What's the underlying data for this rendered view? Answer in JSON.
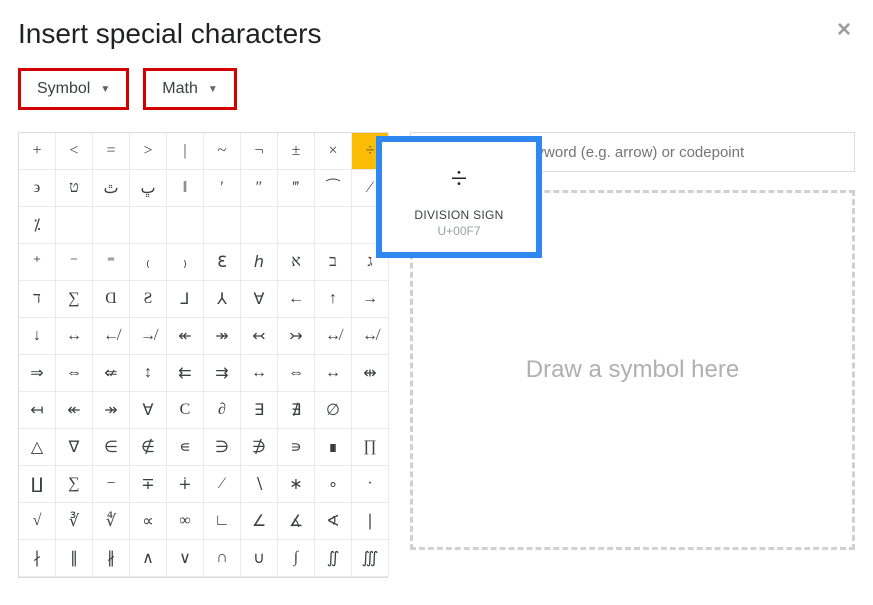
{
  "dialog": {
    "title": "Insert special characters"
  },
  "dropdowns": {
    "category": "Symbol",
    "subcategory": "Math"
  },
  "search": {
    "placeholder": "Search by keyword (e.g. arrow) or codepoint"
  },
  "draw": {
    "placeholder": "Draw a symbol here"
  },
  "tooltip": {
    "glyph": "÷",
    "name": "DIVISION SIGN",
    "codepoint": "U+00F7"
  },
  "selected_index": 9,
  "grid_chars": [
    "+",
    "<",
    "=",
    ">",
    "|",
    "~",
    "¬",
    "±",
    "×",
    "÷",
    "϶",
    "ט",
    "ٿ",
    "ڀ",
    "‖",
    "′",
    "″",
    "‴",
    "⁀",
    "⁄",
    "⁒",
    "",
    "",
    "",
    "",
    "",
    "",
    "",
    "",
    "",
    "⁺",
    "⁻",
    "⁼",
    "₍",
    "₎",
    "ℇ",
    "ℎ",
    "א",
    "ב",
    "ג",
    "ד",
    "∑",
    "Ɑ",
    "Ƨ",
    "⅃",
    "⅄",
    "Ɐ",
    "←",
    "↑",
    "→",
    "↓",
    "↔",
    "↚",
    "↛",
    "↞",
    "↠",
    "↢",
    "↣",
    "↮",
    "↮",
    "⇒",
    "⇔",
    "⇍",
    "↕",
    "⇇",
    "⇉",
    "↔",
    "⇔",
    "↔",
    "⇹",
    "↤",
    "↞",
    "↠",
    "∀",
    "C",
    "∂",
    "∃",
    "∄",
    "∅",
    "",
    "△",
    "∇",
    "∈",
    "∉",
    "∊",
    "∋",
    "∌",
    "∍",
    "∎",
    "∏",
    "∐",
    "∑",
    "−",
    "∓",
    "∔",
    "∕",
    "∖",
    "∗",
    "∘",
    "∙",
    "√",
    "∛",
    "∜",
    "∝",
    "∞",
    "∟",
    "∠",
    "∡",
    "∢",
    "∣",
    "∤",
    "∥",
    "∦",
    "∧",
    "∨",
    "∩",
    "∪",
    "∫",
    "∬",
    "∭"
  ]
}
